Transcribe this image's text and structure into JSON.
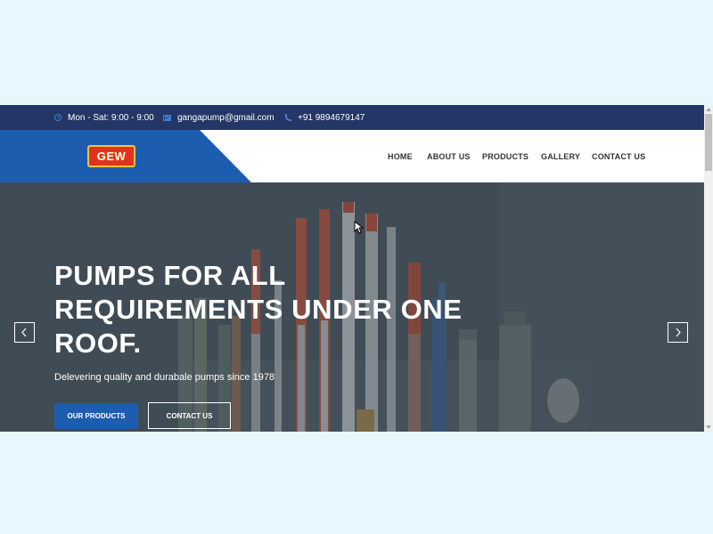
{
  "topbar": {
    "hours": "Mon - Sat: 9:00 - 9:00",
    "email": "gangapump@gmail.com",
    "phone": "+91 9894679147"
  },
  "logo": {
    "text": "GEW"
  },
  "nav": {
    "items": [
      "HOME",
      "ABOUT US",
      "PRODUCTS",
      "GALLERY",
      "CONTACT US"
    ]
  },
  "hero": {
    "title_lines": [
      "PUMPS FOR ALL",
      "REQUIREMENTS UNDER ONE",
      "ROOF."
    ],
    "subtitle": "Delevering quality and durabale pumps since 1978",
    "primary_button": "OUR PRODUCTS",
    "secondary_button": "CONTACT US"
  },
  "colors": {
    "page_background": "#e6f7fe",
    "topbar": "#233665",
    "brand_blue": "#1d5db0",
    "logo_red": "#e0321f"
  }
}
